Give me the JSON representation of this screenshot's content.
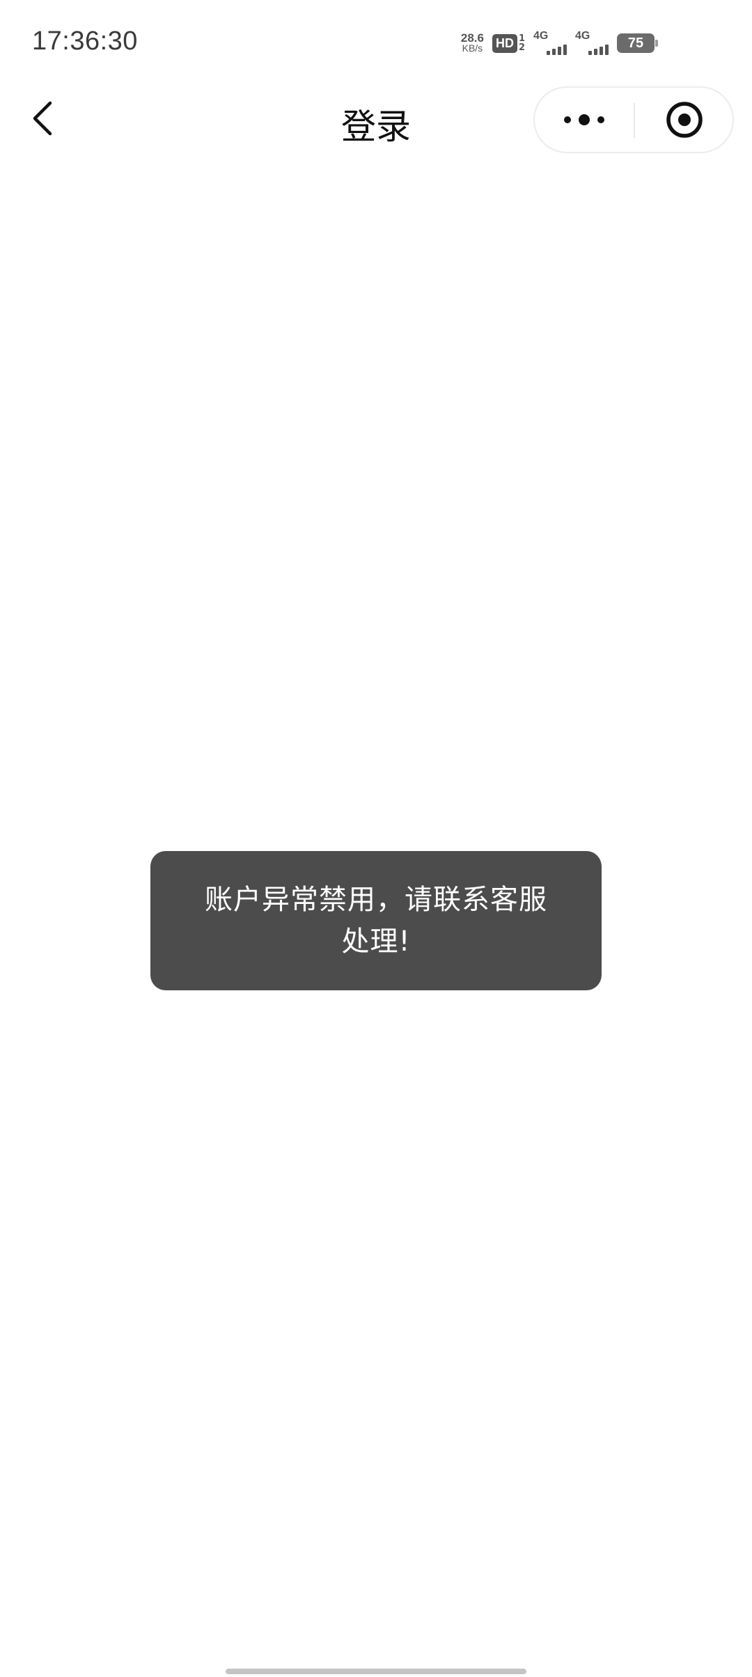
{
  "status_bar": {
    "time": "17:36:30",
    "net_speed_value": "28.6",
    "net_speed_unit": "KB/s",
    "hd_label": "HD",
    "hd_sub_top": "1",
    "hd_sub_bottom": "2",
    "sim1_label": "4G",
    "sim2_label": "4G",
    "battery_level": "75"
  },
  "nav_bar": {
    "back_icon": "chevron-left-icon",
    "title": "登录",
    "more_icon": "more-dots-icon",
    "close_icon": "target-circle-icon"
  },
  "toast": {
    "message": "账户异常禁用，请联系客服处理!"
  },
  "colors": {
    "toast_bg": "#4c4c4c",
    "toast_text": "#ffffff",
    "title_text": "#111111",
    "status_text": "#3a3a3a"
  }
}
